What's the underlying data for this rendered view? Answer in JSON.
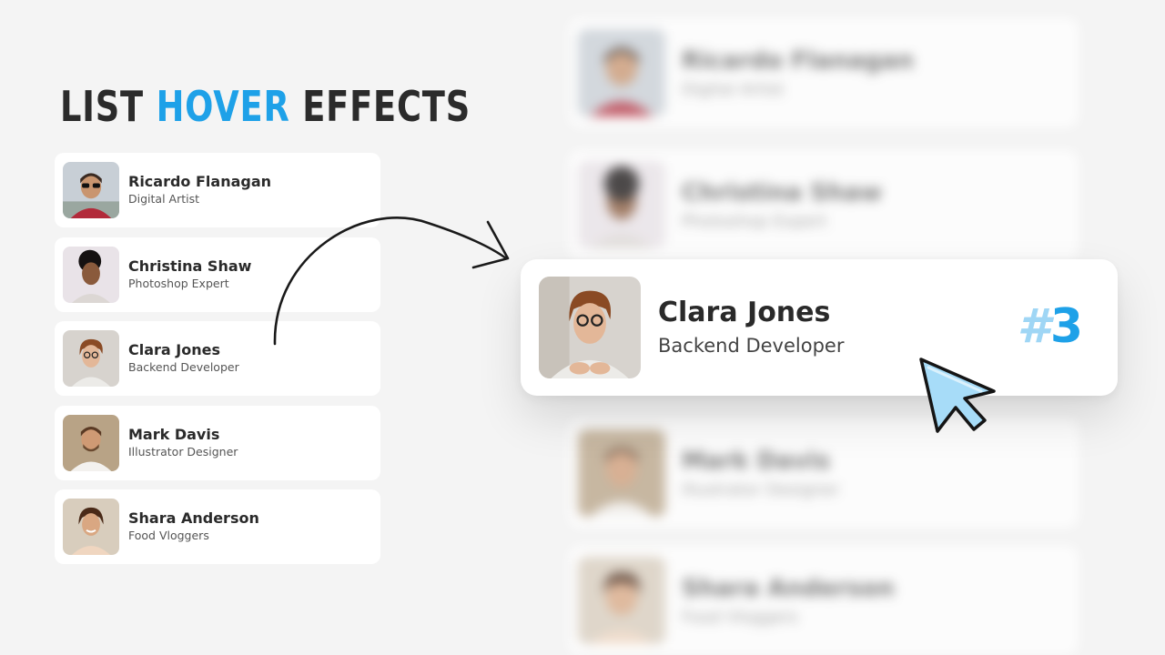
{
  "title": {
    "word1": "LIST",
    "word2": "HOVER",
    "word3": "EFFECTS"
  },
  "list": [
    {
      "name": "Ricardo Flanagan",
      "role": "Digital Artist",
      "avatar_bg": "#c8cfd6",
      "skin": "#c9956f",
      "hair": "#3a2a22",
      "shirt": "#b22a3a"
    },
    {
      "name": "Christina Shaw",
      "role": "Photoshop Expert",
      "avatar_bg": "#e9e3e8",
      "skin": "#8a5a3c",
      "hair": "#151111",
      "shirt": "#dcd7d4"
    },
    {
      "name": "Clara Jones",
      "role": "Backend Developer",
      "avatar_bg": "#d7d3ce",
      "skin": "#e3b798",
      "hair": "#8a4a24",
      "shirt": "#ecebe8"
    },
    {
      "name": "Mark Davis",
      "role": "Illustrator Designer",
      "avatar_bg": "#b8a386",
      "skin": "#cf9a74",
      "hair": "#5a3a24",
      "shirt": "#f3f1ee"
    },
    {
      "name": "Shara Anderson",
      "role": "Food Vloggers",
      "avatar_bg": "#d8cdbd",
      "skin": "#d9a782",
      "hair": "#4a2a18",
      "shirt": "#f0d6c0"
    }
  ],
  "featured": {
    "name": "Clara Jones",
    "role": "Backend Developer",
    "rank_hash": "#",
    "rank_number": "3"
  },
  "blurred": [
    {
      "name": "Ricardo Flanagan",
      "role": "Digital Artist"
    },
    {
      "name": "Christina Shaw",
      "role": "Photoshop Expert"
    },
    {
      "name": "Mark Davis",
      "role": "Illustrator Designer"
    },
    {
      "name": "Shara Anderson",
      "role": "Food Vloggers"
    }
  ],
  "colors": {
    "accent": "#1ea1e8",
    "accent_light": "#9fd6f5",
    "background": "#f4f4f4",
    "card": "#ffffff",
    "cursor_fill": "#a7dcf8"
  },
  "icons": {
    "arrow": "curved-arrow-icon",
    "cursor": "mouse-pointer-icon"
  }
}
